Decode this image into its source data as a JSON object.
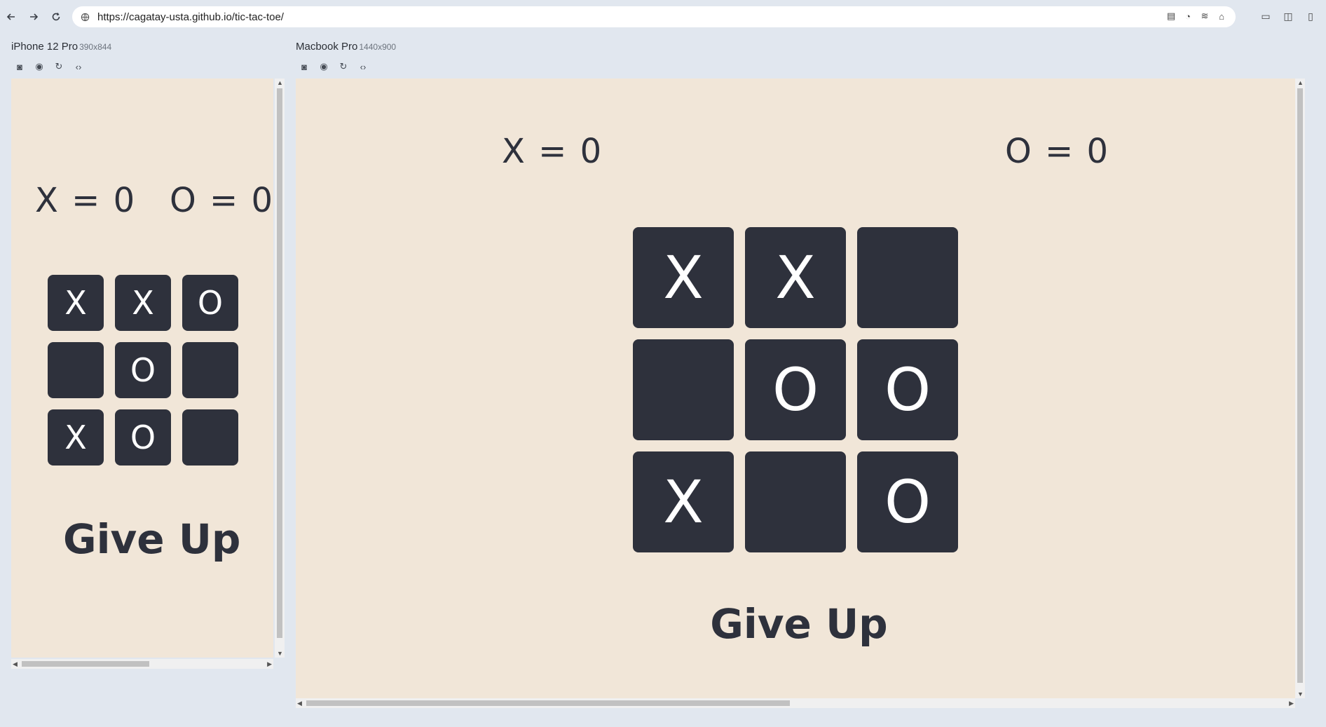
{
  "browser": {
    "url": "https://cagatay-usta.github.io/tic-tac-toe/",
    "back_icon": "arrow-left-icon",
    "forward_icon": "arrow-right-icon",
    "reload_icon": "reload-icon"
  },
  "devices": {
    "iphone": {
      "name": "iPhone 12 Pro",
      "dimensions": "390x844"
    },
    "macbook": {
      "name": "Macbook Pro",
      "dimensions": "1440x900"
    }
  },
  "game_iphone": {
    "score_x": "X = 0",
    "score_o": "O = 0",
    "board": [
      "X",
      "X",
      "O",
      "",
      "O",
      "",
      "X",
      "O",
      ""
    ],
    "give_up": "Give Up"
  },
  "game_macbook": {
    "score_x": "X = 0",
    "score_o": "O = 0",
    "board": [
      "X",
      "X",
      "",
      "",
      "O",
      "O",
      "X",
      "",
      "O"
    ],
    "give_up": "Give Up"
  },
  "colors": {
    "page_bg": "#e1e7ef",
    "viewport_bg": "#f1e6d8",
    "cell_bg": "#2e313c",
    "mark": "#ffffff"
  }
}
